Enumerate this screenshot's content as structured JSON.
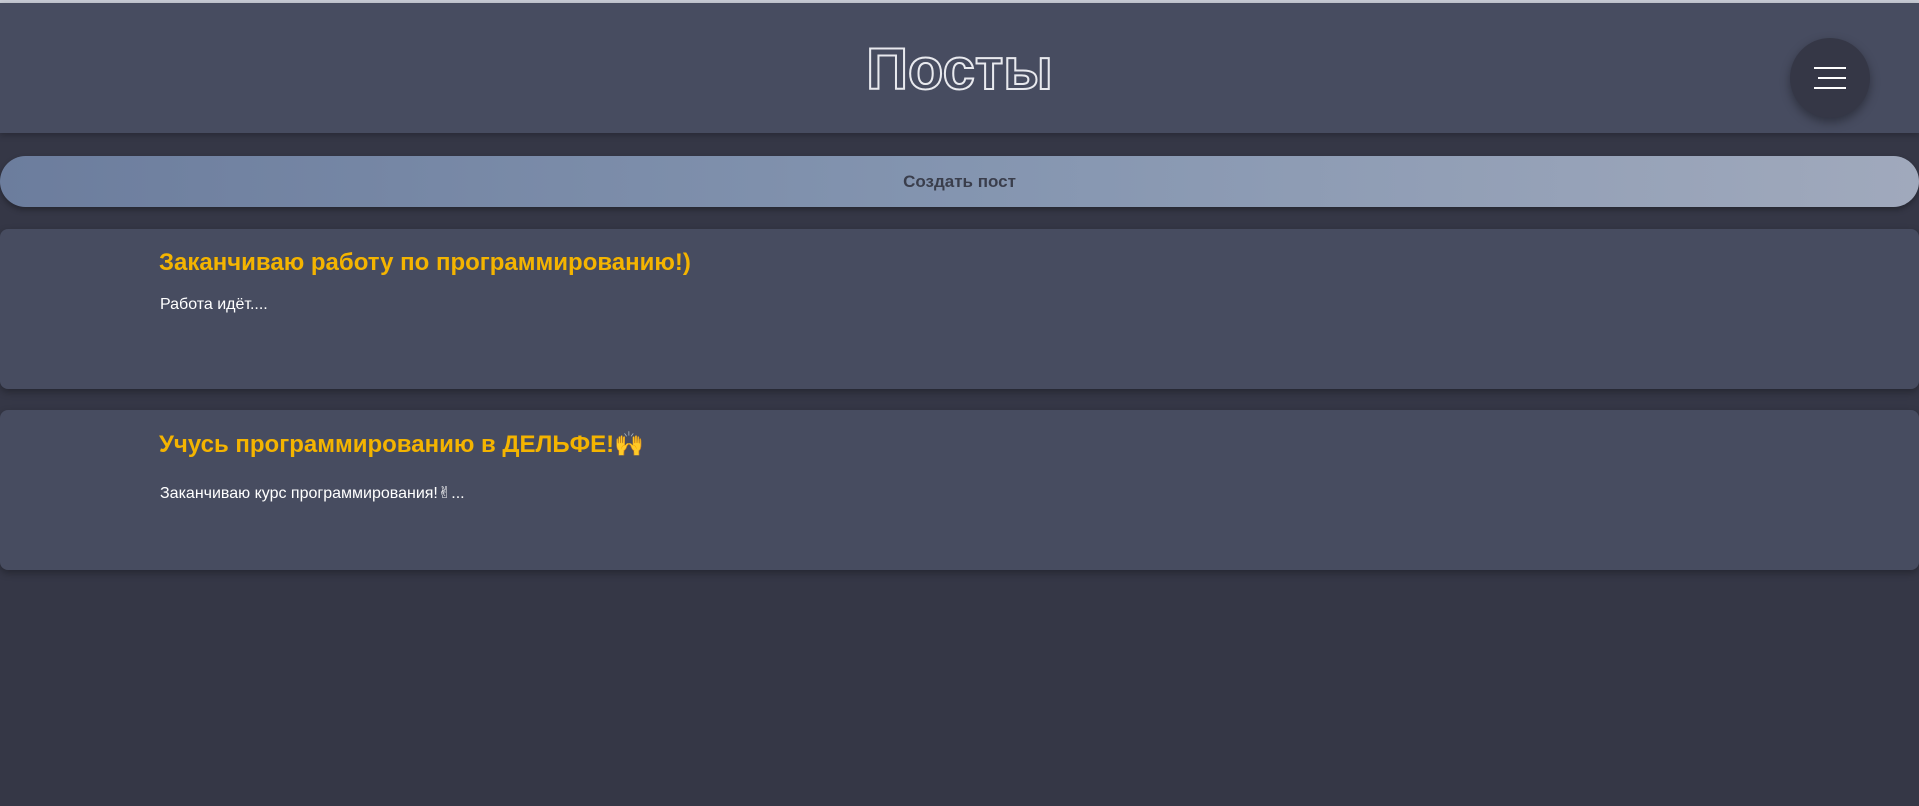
{
  "header": {
    "title": "Посты",
    "menu_icon": "hamburger-menu-icon"
  },
  "actions": {
    "create_post_label": "Создать пост"
  },
  "posts": [
    {
      "title": "Заканчиваю работу по программированию!)",
      "body": "Работа идёт...."
    },
    {
      "title": "Учусь программированию в ДЕЛЬФЕ!🙌",
      "body": "Заканчиваю курс программирования!✌..."
    }
  ],
  "colors": {
    "background": "#353746",
    "header": "#474c60",
    "card": "#474c60",
    "post_title": "#f4b400",
    "post_body": "#ffffff"
  }
}
